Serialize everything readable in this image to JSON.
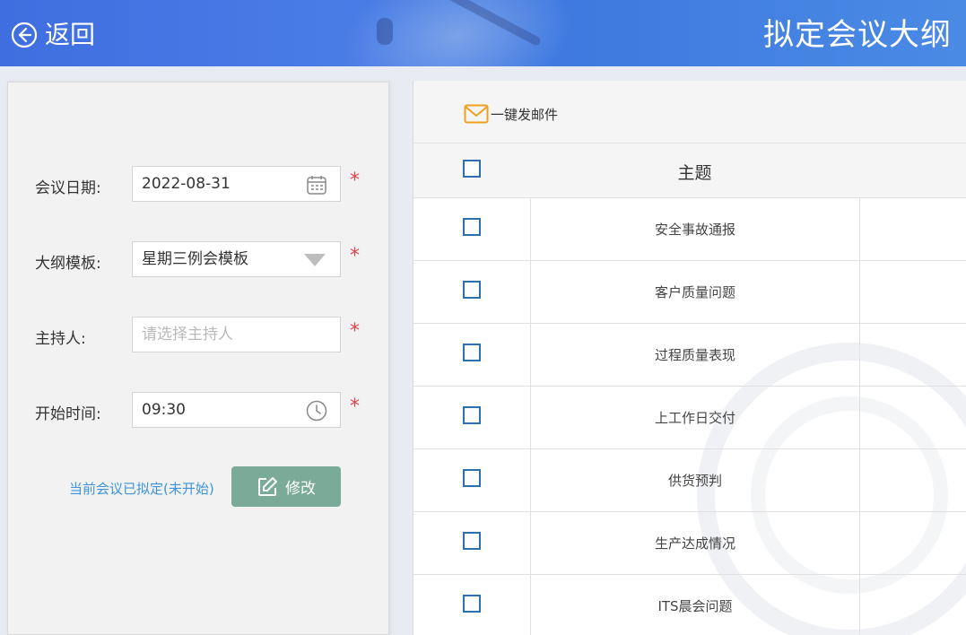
{
  "header": {
    "back_label": "返回",
    "page_title": "拟定会议大纲"
  },
  "form": {
    "date": {
      "label": "会议日期:",
      "value": "2022-08-31"
    },
    "template": {
      "label": "大纲模板:",
      "value": "星期三例会模板"
    },
    "host": {
      "label": "主持人:",
      "placeholder": "请选择主持人"
    },
    "start_time": {
      "label": "开始时间:",
      "value": "09:30"
    },
    "required_mark": "*",
    "status_text": "当前会议已拟定(未开始)",
    "modify_label": "修改"
  },
  "toolbar": {
    "email_label": "一键发邮件"
  },
  "table": {
    "header_topic": "主题",
    "rows": [
      {
        "topic": "安全事故通报"
      },
      {
        "topic": "客户质量问题"
      },
      {
        "topic": "过程质量表现"
      },
      {
        "topic": "上工作日交付"
      },
      {
        "topic": "供货预判"
      },
      {
        "topic": "生产达成情况"
      },
      {
        "topic": "ITS晨会问题"
      }
    ]
  },
  "colors": {
    "header_blue": "#3f6ee0",
    "required_red": "#e0464c",
    "status_blue": "#3d93dc",
    "modify_green": "#7aab98",
    "checkbox_blue": "#2f6fb0",
    "mail_orange": "#f0a020"
  }
}
